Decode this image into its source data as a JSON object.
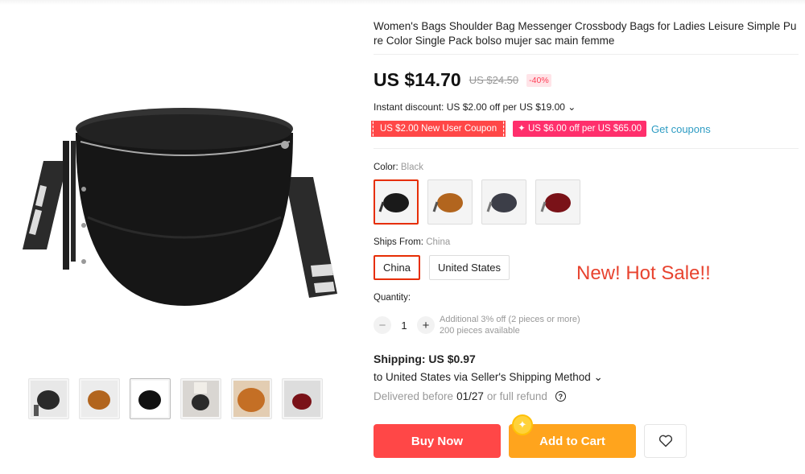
{
  "product": {
    "title": "Women's Bags Shoulder Bag Messenger Crossbody Bags for Ladies Leisure Simple Pure Color Single Pack bolso mujer sac main femme"
  },
  "price": {
    "current": "US $14.70",
    "original": "US $24.50",
    "discount": "-40%"
  },
  "instant_discount": "Instant discount: US $2.00 off per US $19.00 ⌄",
  "coupons": {
    "new_user": "US $2.00 New User Coupon",
    "store": "✦ US $6.00 off per US $65.00",
    "get_link": "Get coupons"
  },
  "color": {
    "label": "Color: ",
    "selected": "Black",
    "options": [
      "Black",
      "Brown",
      "Gray",
      "Red"
    ],
    "swatch_colors": [
      "#1a1a1a",
      "#b2651e",
      "#3c3e48",
      "#7a1218"
    ]
  },
  "ships_from": {
    "label": "Ships From: ",
    "selected": "China",
    "options": [
      "China",
      "United States"
    ]
  },
  "promo": "New! Hot Sale!!",
  "quantity": {
    "label": "Quantity:",
    "value": "1",
    "minus": "−",
    "plus": "+",
    "info_line1": "Additional 3% off (2 pieces or more)",
    "info_line2": "200 pieces available"
  },
  "shipping": {
    "title": "Shipping: US $0.97",
    "method": "to United States via Seller's Shipping Method ⌄",
    "delivery_prefix": "Delivered before",
    "delivery_date": "01/27",
    "delivery_suffix": "or full refund"
  },
  "actions": {
    "buy_now": "Buy Now",
    "add_to_cart": "Add to Cart"
  },
  "colors": {
    "accent_red": "#ff4747",
    "orange": "#ffa41d",
    "hot_sale": "#e8432f",
    "link_blue": "#2e9cc3"
  }
}
